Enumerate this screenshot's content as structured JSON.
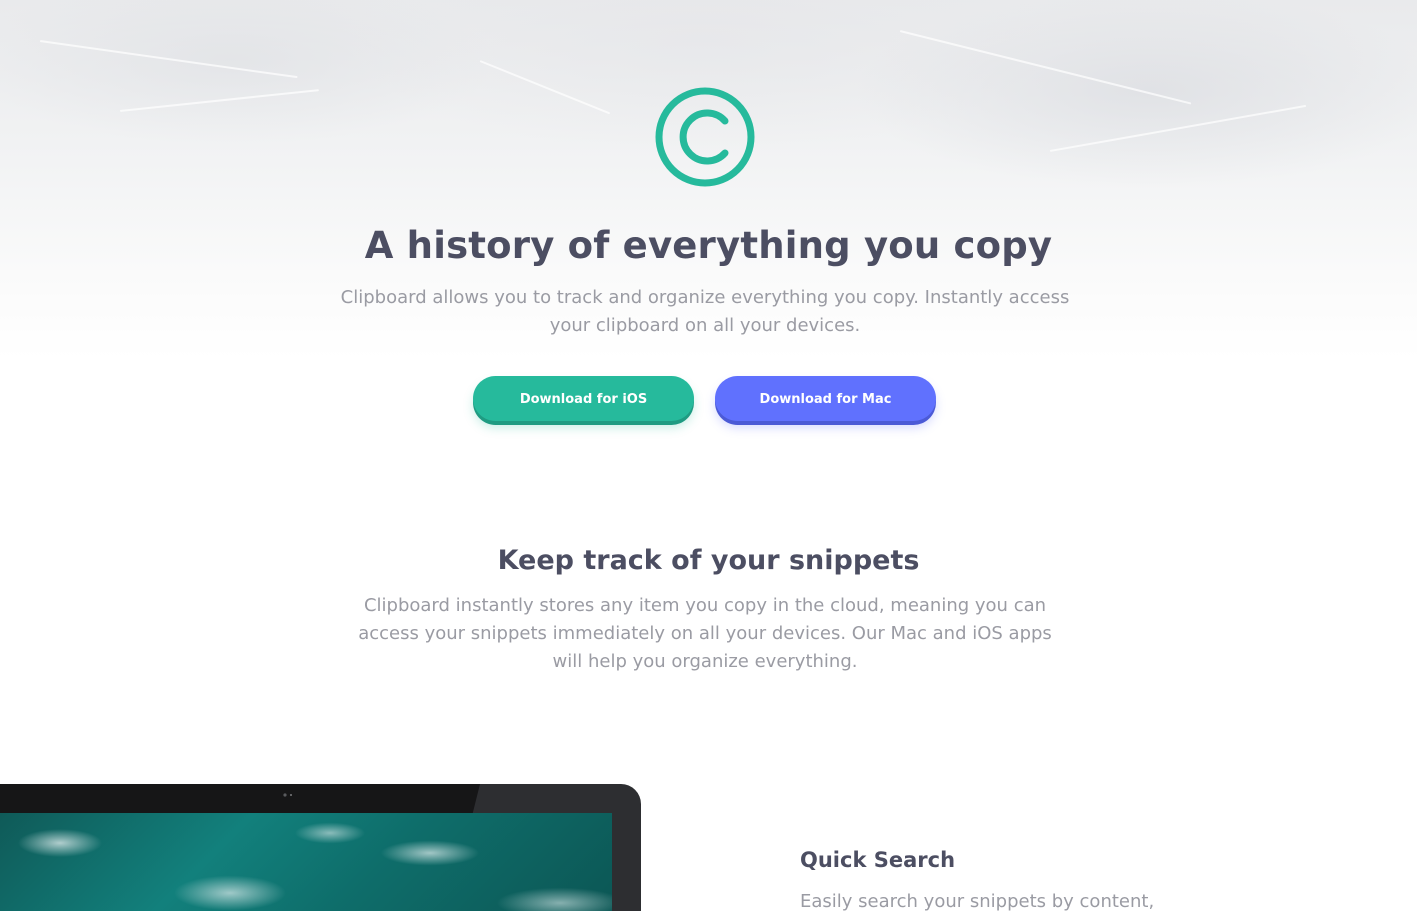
{
  "colors": {
    "accent_green": "#26ba9c",
    "accent_blue": "#6071fe",
    "heading": "#4c4e62",
    "body_text": "#9a9ba3"
  },
  "hero": {
    "logo_icon": "copyright-circle-icon",
    "title": "A history of everything you copy",
    "subtitle": "Clipboard allows you to track and organize everything you copy. Instantly access your clipboard on all your devices.",
    "buttons": {
      "ios_label": "Download for iOS",
      "mac_label": "Download for Mac"
    }
  },
  "snippets": {
    "title": "Keep track of your snippets",
    "text": "Clipboard instantly stores any item you copy in the cloud, meaning you can access your snippets immediately on all your devices. Our Mac and iOS apps will help you organize everything."
  },
  "features": {
    "image_icon": "computer-device-image",
    "items": [
      {
        "title": "Quick Search",
        "text": "Easily search your snippets by content,"
      }
    ]
  }
}
